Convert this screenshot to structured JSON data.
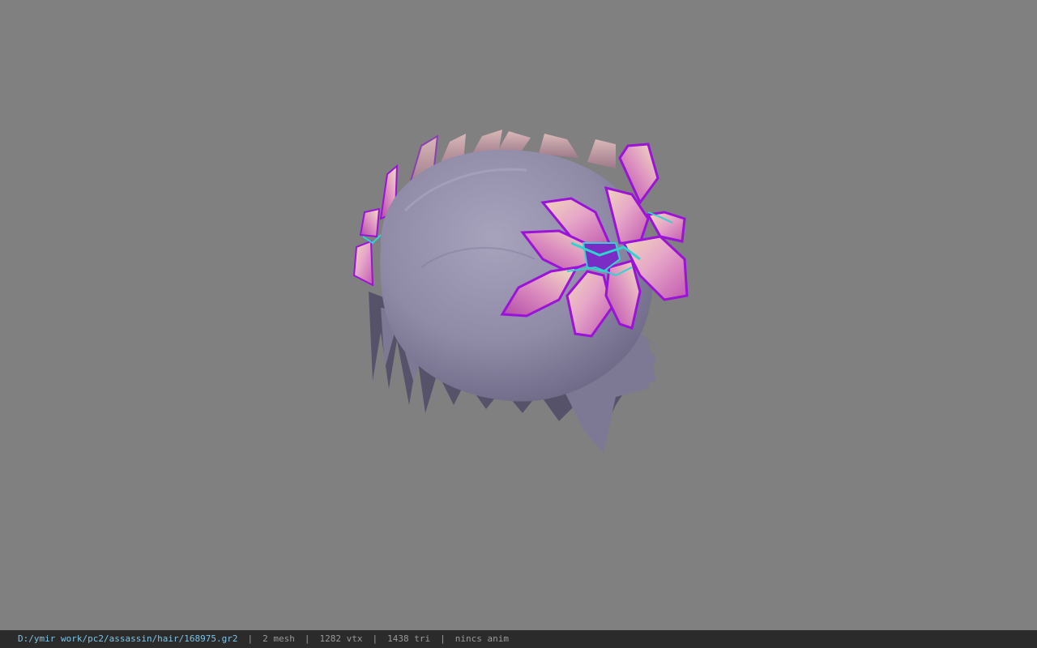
{
  "status": {
    "file_path": "D:/ymir work/pc2/assassin/hair/168975.gr2",
    "separator": "|",
    "mesh": "2 mesh",
    "vertices": "1282 vtx",
    "triangles": "1438 tri",
    "anim": "nincs anim"
  },
  "colors": {
    "background": "#808080",
    "statusbar": "#2b2b2b",
    "path_text": "#7ec3e6",
    "info_text": "#9a9a9a",
    "hair": "#8f8aa6",
    "petal_outline": "#9b12d8",
    "petal_fill": "#e6a6c8",
    "petal_accent": "#2fd3cf"
  },
  "model": {
    "icon": "hair-model-with-flower-crown"
  }
}
